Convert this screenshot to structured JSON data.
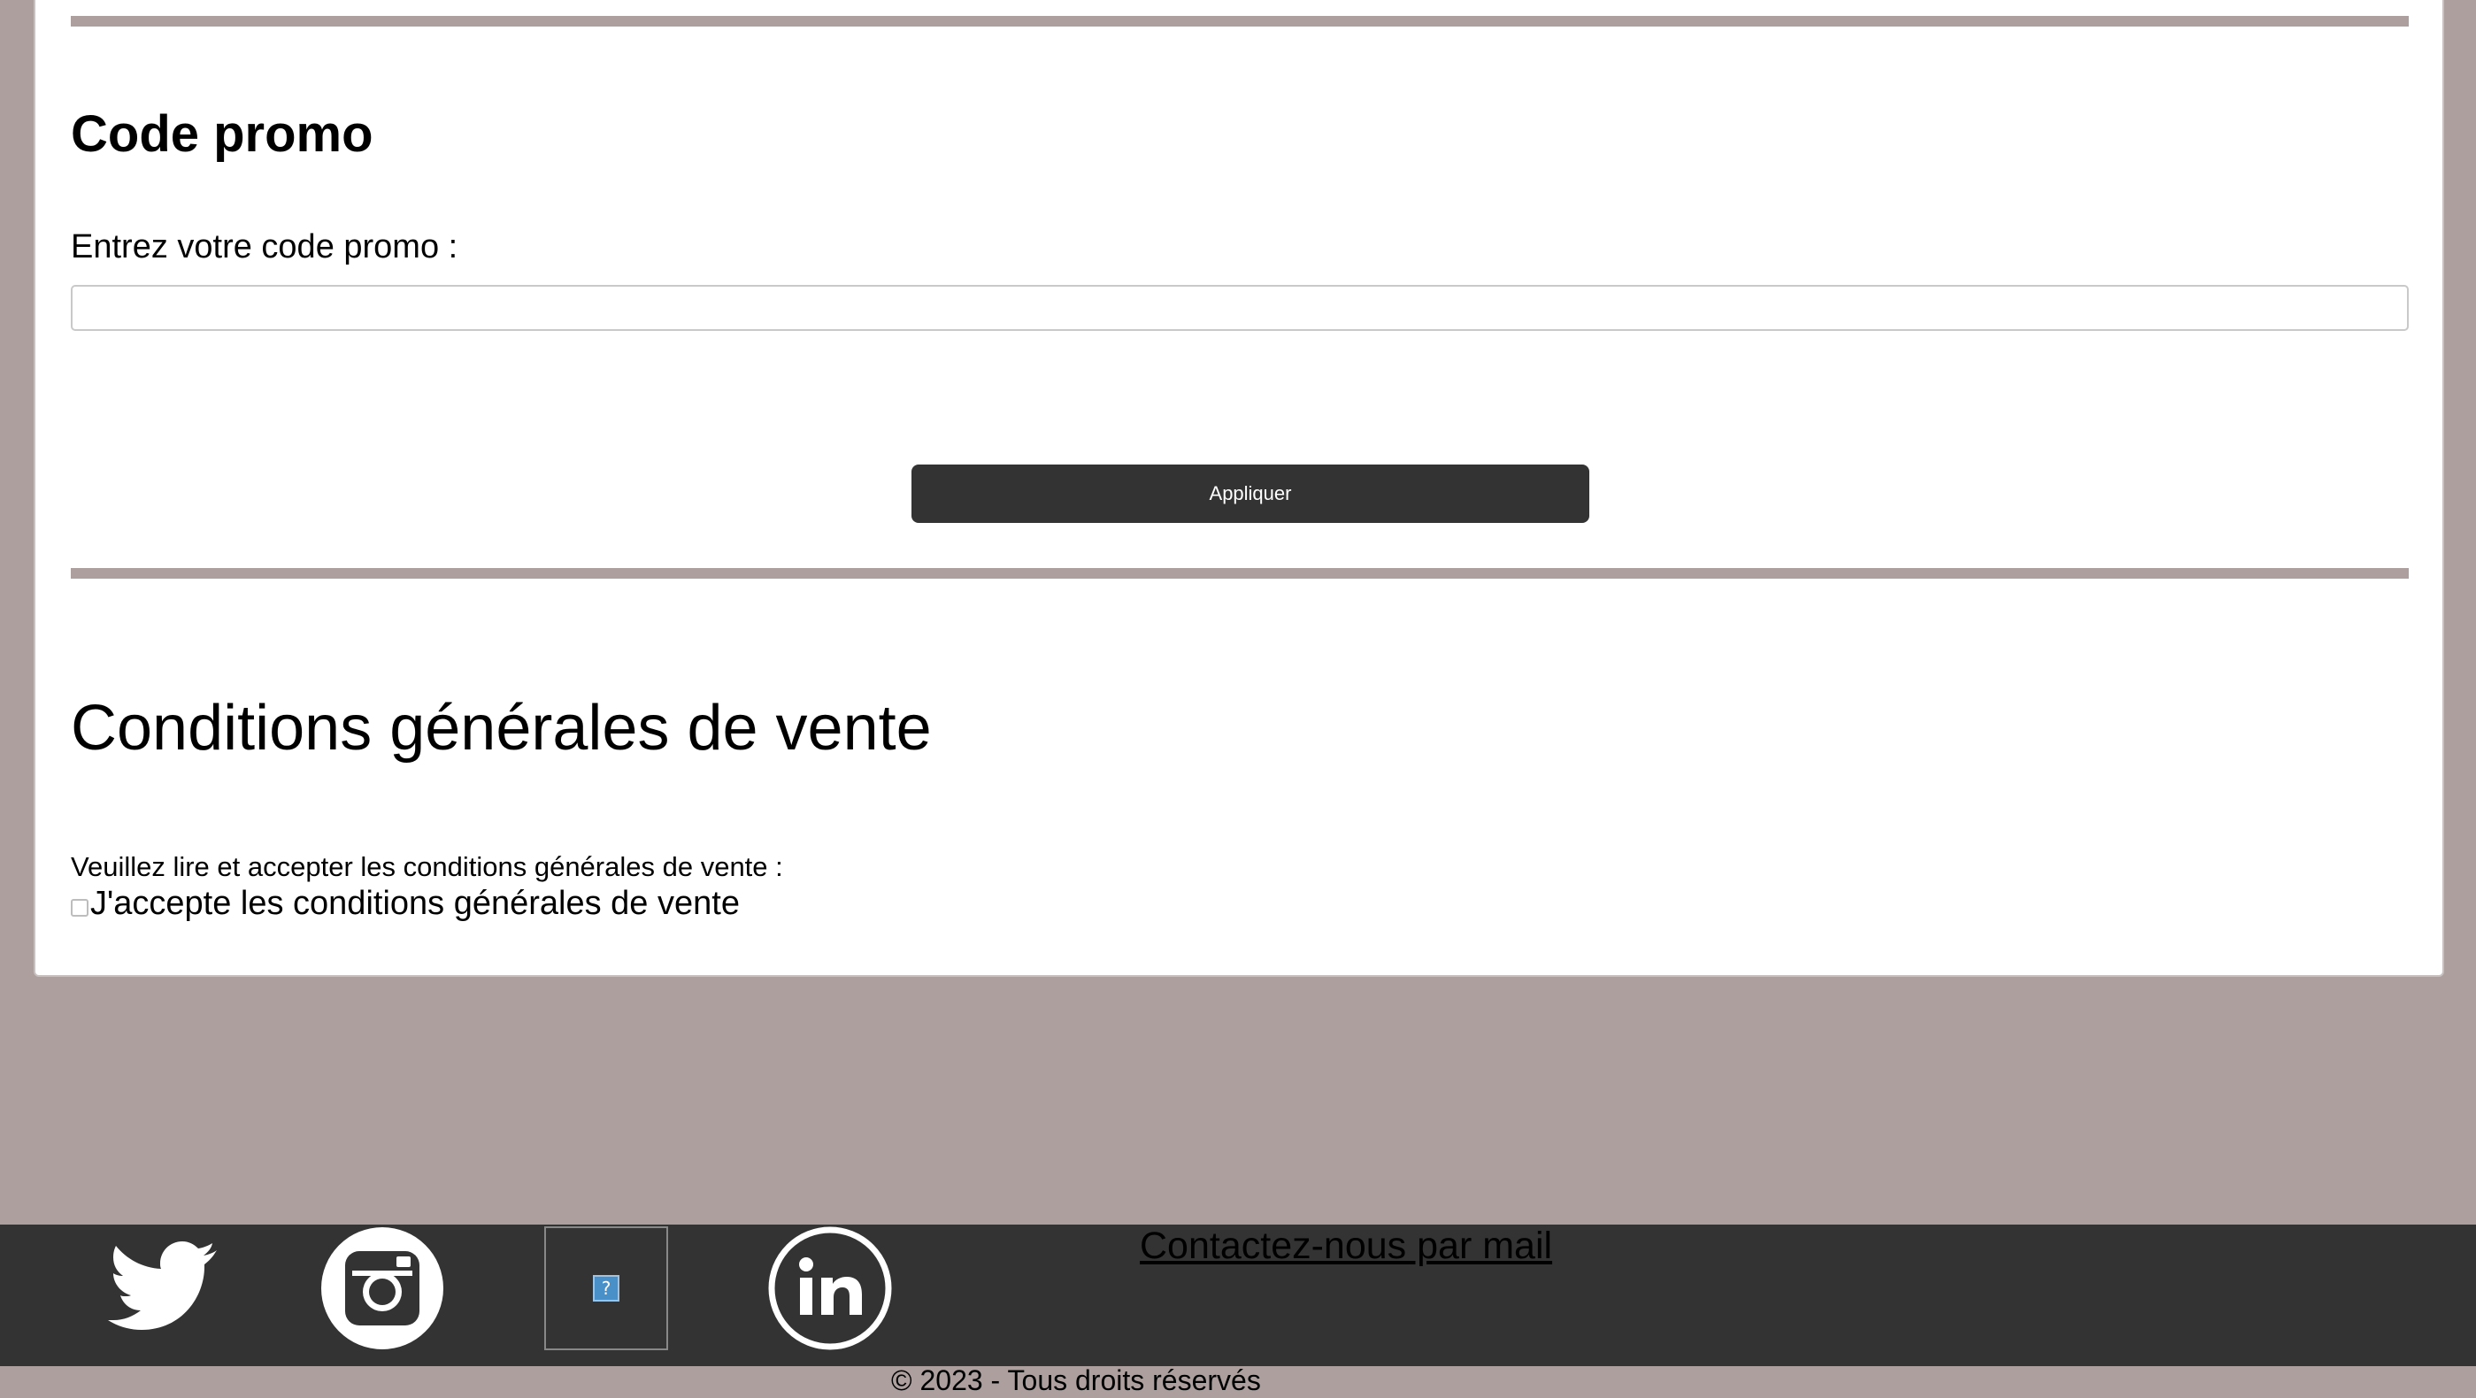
{
  "promo": {
    "title": "Code promo",
    "label": "Entrez votre code promo :",
    "input_value": "",
    "input_placeholder": "",
    "apply_label": "Appliquer"
  },
  "cgv": {
    "title": "Conditions générales de vente",
    "instruction": "Veuillez lire et accepter les conditions générales de vente :",
    "accept_label": "J'accepte les conditions générales de vente",
    "accepted": false
  },
  "footer": {
    "social_icons": [
      "twitter-icon",
      "instagram-icon",
      "broken-image-icon",
      "linkedin-icon"
    ],
    "broken_image_glyph": "?",
    "contact_link": "Contactez-nous par mail",
    "copyright": "© 2023 - Tous droits réservés"
  },
  "colors": {
    "page_background": "#ac9f9e",
    "card_background": "#ffffff",
    "button_background": "#333333",
    "footer_background": "#333333"
  }
}
